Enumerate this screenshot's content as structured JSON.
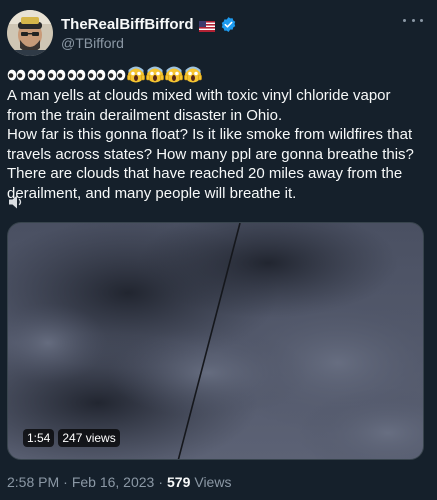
{
  "author": {
    "display_name": "TheRealBiffBifford",
    "handle": "@TBifford",
    "flag_icon": "us-flag-icon",
    "verified_icon": "verified-badge-icon",
    "verified_color": "#1d9bf0"
  },
  "tweet": {
    "emoji_sequence": [
      "eyes",
      "eyes",
      "eyes",
      "eyes",
      "eyes",
      "eyes",
      "scream",
      "scream",
      "scream",
      "scream"
    ],
    "text": "A man yells at clouds mixed with toxic vinyl chloride vapor\nfrom the train derailment disaster in Ohio.\nHow far is this gonna float? Is it like smoke from wildfires that\ntravels across states? How many ppl are gonna breathe this?\nThere are clouds that have reached 20 miles away from the\nderailment, and many people will breathe it.",
    "trailing_icon": "speaker-icon"
  },
  "media": {
    "type": "video",
    "duration": "1:54",
    "views_label": "247 views"
  },
  "meta": {
    "time": "2:58 PM",
    "separator": "·",
    "date": "Feb 16, 2023",
    "views_count": "579",
    "views_label": "Views"
  },
  "colors": {
    "background": "#15202b",
    "text_primary": "#f7f9f9",
    "text_secondary": "#8b98a5",
    "accent": "#1d9bf0"
  }
}
